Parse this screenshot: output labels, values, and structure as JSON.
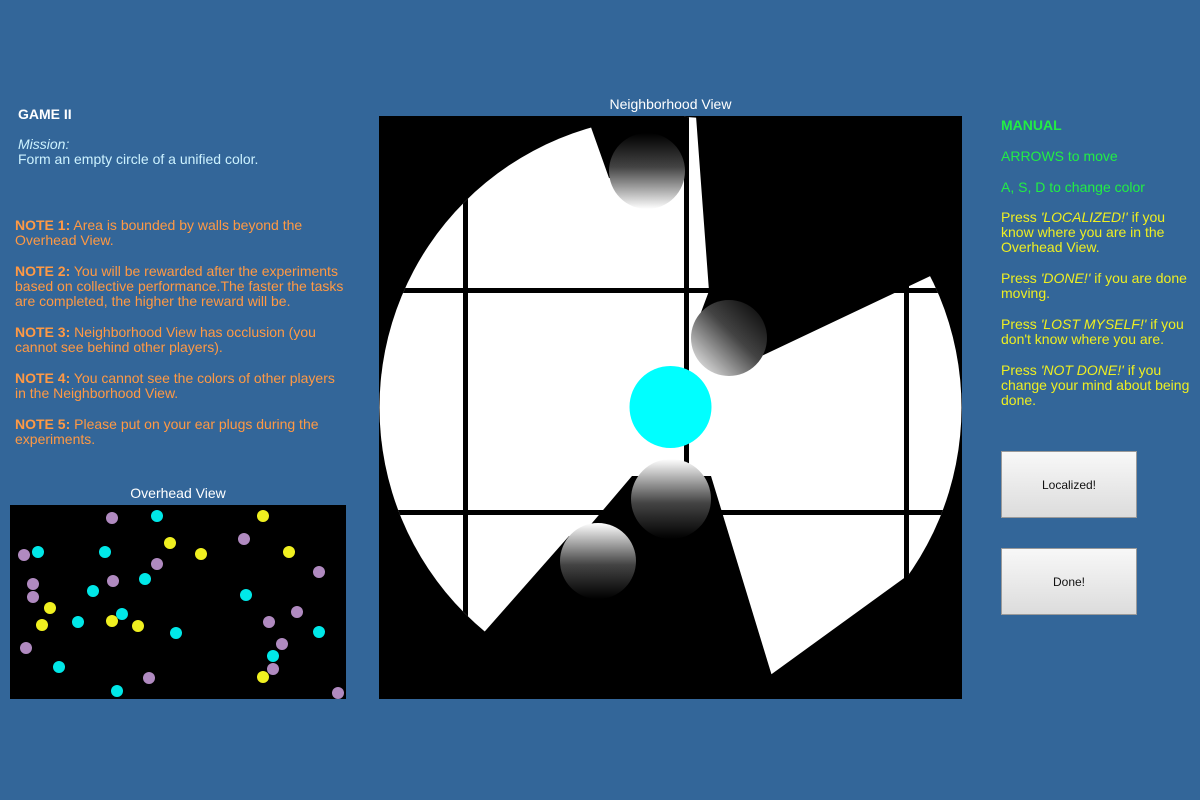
{
  "left": {
    "title": "GAME II",
    "mission_label": "Mission:",
    "mission_text": "Form an empty circle of a unified color.",
    "notes": [
      {
        "label": "NOTE 1:",
        "text": "Area is bounded by walls beyond the Overhead View."
      },
      {
        "label": "NOTE 2:",
        "text": "You will be rewarded after the experiments based on collective performance.The faster the tasks are completed, the higher the reward will be."
      },
      {
        "label": "NOTE 3:",
        "text": "Neighborhood View has occlusion (you cannot see behind other players)."
      },
      {
        "label": "NOTE 4:",
        "text": "You cannot see the colors of other players in the Neighborhood View."
      },
      {
        "label": "NOTE 5:",
        "text": "Please put on your ear plugs during the experiments."
      }
    ]
  },
  "overhead": {
    "label": "Overhead View",
    "colors": {
      "purple": "#b08ac0",
      "cyan": "#00e8e8",
      "yellow": "#f0f020"
    }
  },
  "neighborhood": {
    "label": "Neighborhood View",
    "self_color": "#00ffff"
  },
  "manual": {
    "title": "MANUAL",
    "arrows": "ARROWS to move",
    "asd": "A, S, D to change color",
    "localized": {
      "pre": "Press ",
      "key": "'LOCALIZED!'",
      "post": " if you know where you are in the Overhead View."
    },
    "done": {
      "pre": "Press ",
      "key": "'DONE!'",
      "post": " if you are done moving."
    },
    "lost": {
      "pre": "Press ",
      "key": "'LOST MYSELF!'",
      "post": " if you don't know where you are."
    },
    "notdone": {
      "pre": "Press ",
      "key": "'NOT DONE!'",
      "post": " if you change your mind about being done."
    }
  },
  "buttons": {
    "localized": "Localized!",
    "done": "Done!"
  }
}
